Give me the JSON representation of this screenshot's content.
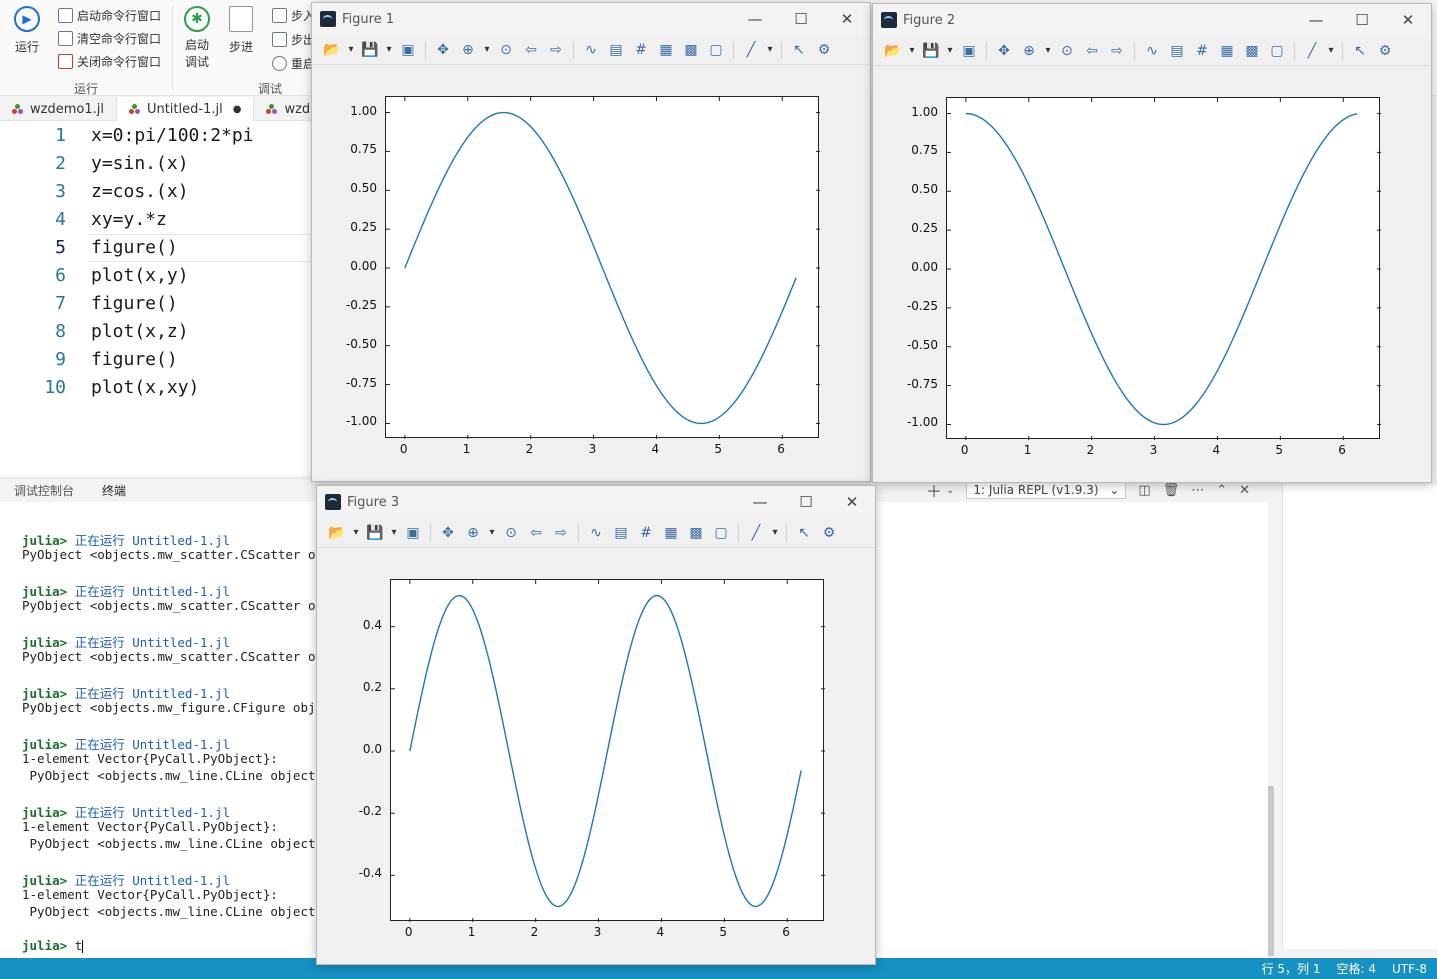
{
  "ribbon": {
    "run_label": "运行",
    "start_cmd": "启动命令行窗口",
    "clear_cmd": "清空命令行窗口",
    "close_cmd": "关闭命令行窗口",
    "group_run": "运行",
    "start_debug_1": "启动",
    "start_debug_2": "调试",
    "step_label": "步进",
    "step_in": "步入",
    "step_out": "步出",
    "restart": "重启",
    "group_debug": "调试"
  },
  "tabs": [
    {
      "label": "wzdemo1.jl",
      "dirty": false
    },
    {
      "label": "Untitled-1.jl",
      "dirty": true,
      "dirty_mark": "●"
    },
    {
      "label": "wzd",
      "dirty": false
    }
  ],
  "editor": {
    "lines": [
      {
        "num": "1",
        "text": "x=0:pi/100:2*pi"
      },
      {
        "num": "2",
        "text": "y=sin.(x)"
      },
      {
        "num": "3",
        "text": "z=cos.(x)"
      },
      {
        "num": "4",
        "text": "xy=y.*z"
      },
      {
        "num": "5",
        "text": "figure()"
      },
      {
        "num": "6",
        "text": "plot(x,y)"
      },
      {
        "num": "7",
        "text": "figure()"
      },
      {
        "num": "8",
        "text": "plot(x,z)"
      },
      {
        "num": "9",
        "text": "figure()"
      },
      {
        "num": "10",
        "text": "plot(x,xy)"
      }
    ],
    "current_line": 5
  },
  "panel": {
    "tabs": [
      "调试控制台",
      "终端"
    ],
    "active_tab": "终端",
    "terminal_selector": "1: Julia REPL (v1.9.3)",
    "icons": [
      "plus-icon",
      "chevron-down-icon",
      "split-icon",
      "trash-icon",
      "more-icon",
      "chevron-up-icon",
      "close-icon"
    ]
  },
  "terminal": {
    "prompt": "julia>",
    "running": "正在运行",
    "file": "Untitled-1.jl",
    "entries": [
      {
        "lines": [
          "PyObject <objects.mw_scatter.CScatter obje"
        ]
      },
      {
        "lines": [
          "PyObject <objects.mw_scatter.CScatter obje"
        ]
      },
      {
        "lines": [
          "PyObject <objects.mw_scatter.CScatter obje"
        ]
      },
      {
        "lines": [
          "PyObject <objects.mw_figure.CFigure object"
        ]
      },
      {
        "lines": [
          "1-element Vector{PyCall.PyObject}:",
          " PyObject <objects.mw_line.CLine object at"
        ]
      },
      {
        "lines": [
          "1-element Vector{PyCall.PyObject}:",
          " PyObject <objects.mw_line.CLine object at"
        ]
      },
      {
        "lines": [
          "1-element Vector{PyCall.PyObject}:",
          " PyObject <objects.mw_line.CLine object at"
        ]
      }
    ],
    "input": "t"
  },
  "status": {
    "position": "行 5，列 1",
    "spaces": "空格: 4",
    "encoding": "UTF-8"
  },
  "colors": {
    "line": "#1f77b4",
    "status_bar": "#1591c4",
    "prompt": "#1a6f2e",
    "link": "#1a5fb4"
  },
  "figures": [
    {
      "title": "Figure 1"
    },
    {
      "title": "Figure 2"
    },
    {
      "title": "Figure 3"
    }
  ],
  "chart_data": [
    {
      "type": "line",
      "function": "sin",
      "x_range": [
        0,
        6.2204
      ],
      "xticks": [
        "0",
        "1",
        "2",
        "3",
        "4",
        "5",
        "6"
      ],
      "yticks": [
        "1.00",
        "0.75",
        "0.50",
        "0.25",
        "0.00",
        "-0.25",
        "-0.50",
        "-0.75",
        "-1.00"
      ],
      "xlim": [
        -0.3,
        6.6
      ],
      "ylim": [
        -1.1,
        1.1
      ],
      "series": [
        {
          "x": [
            0,
            0.5,
            1.0,
            1.5708,
            2.0,
            2.5,
            3.0,
            3.5,
            4.0,
            4.7124,
            5.0,
            5.5,
            6.0,
            6.2204
          ],
          "values": [
            0,
            0.479,
            0.841,
            1.0,
            0.909,
            0.598,
            0.141,
            -0.351,
            -0.757,
            -1.0,
            -0.959,
            -0.706,
            -0.279,
            -0.063
          ]
        }
      ]
    },
    {
      "type": "line",
      "function": "cos",
      "x_range": [
        0,
        6.2204
      ],
      "xticks": [
        "0",
        "1",
        "2",
        "3",
        "4",
        "5",
        "6"
      ],
      "yticks": [
        "1.00",
        "0.75",
        "0.50",
        "0.25",
        "0.00",
        "-0.25",
        "-0.50",
        "-0.75",
        "-1.00"
      ],
      "xlim": [
        -0.3,
        6.6
      ],
      "ylim": [
        -1.1,
        1.1
      ],
      "series": [
        {
          "x": [
            0,
            0.5,
            1.0,
            1.5708,
            2.0,
            2.5,
            3.1416,
            3.5,
            4.0,
            4.7124,
            5.0,
            5.5,
            6.0,
            6.2204
          ],
          "values": [
            1.0,
            0.878,
            0.54,
            0.0,
            -0.416,
            -0.801,
            -1.0,
            -0.936,
            -0.654,
            0.0,
            0.284,
            0.709,
            0.96,
            0.998
          ]
        }
      ]
    },
    {
      "type": "line",
      "function": "sin*cos",
      "x_range": [
        0,
        6.2204
      ],
      "xticks": [
        "0",
        "1",
        "2",
        "3",
        "4",
        "5",
        "6"
      ],
      "yticks": [
        "0.4",
        "0.2",
        "0.0",
        "-0.2",
        "-0.4"
      ],
      "xlim": [
        -0.3,
        6.6
      ],
      "ylim": [
        -0.55,
        0.55
      ],
      "series": [
        {
          "x": [
            0,
            0.3927,
            0.7854,
            1.1781,
            1.5708,
            1.9635,
            2.3562,
            2.7489,
            3.1416,
            3.5343,
            3.927,
            4.3197,
            4.7124,
            5.1051,
            5.4978,
            5.8905,
            6.2204
          ],
          "values": [
            0,
            0.354,
            0.5,
            0.354,
            0,
            -0.354,
            -0.5,
            -0.354,
            0,
            0.354,
            0.5,
            0.354,
            0,
            -0.354,
            -0.5,
            -0.354,
            -0.063
          ]
        }
      ]
    }
  ]
}
